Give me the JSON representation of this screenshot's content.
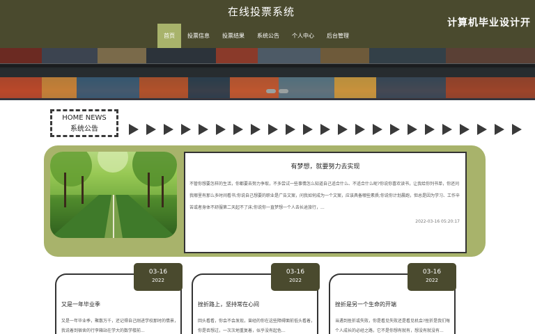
{
  "header": {
    "site_title": "在线投票系统",
    "watermark": "计算机毕业设计开",
    "nav": [
      {
        "label": "首页",
        "active": true
      },
      {
        "label": "投票信息",
        "active": false
      },
      {
        "label": "投票结果",
        "active": false
      },
      {
        "label": "系统公告",
        "active": false
      },
      {
        "label": "个人中心",
        "active": false
      },
      {
        "label": "后台管理",
        "active": false
      }
    ]
  },
  "banner": {
    "slides": 2,
    "active_slide": 1
  },
  "news_section": {
    "title_en": "HOME NEWS",
    "title_cn": "系统公告"
  },
  "featured": {
    "title": "有梦想，就要努力去实现",
    "text": "不管你想要怎样的生活，你都要去努力争取，不多尝试一些事情怎么知道自己适合什么、不适合什么呢?你说你喜欢读书，让我给你列书单，你还问我哪里有那么多时间看书;你说自己想要的职业是广告文案，问我如何成为一个文案，应该具备哪些素质;你说你计划晨跑，但总是因为学习、工作辛苦或者身体不舒服第二天起不了床;你说你一直梦想一个人去长途旅行，...",
    "date": "2022-03-16 05:20:17"
  },
  "cards": [
    {
      "month_day": "03-16",
      "year": "2022",
      "title": "又是一年毕业季",
      "text": "又是一年毕业季，聚散万千，还记得自己刚进学校那时的情景，我说着到宿舍的行李箱站在学大的数学楼前..."
    },
    {
      "month_day": "03-16",
      "year": "2022",
      "title": "挫折路上，坚持常在心间",
      "text": "回头看看，你会不会发现，曾经的你在这些障碍面前低头看着，你是否想过，一次次地重复着，似乎没有起色..."
    },
    {
      "month_day": "03-16",
      "year": "2022",
      "title": "挫折是另一个生命的开端",
      "text": "当遇到挫折或失败，你是看见失败还是看见机会?挫折是我们每个人成长的必经之路，它不是你想有就有，想没有就没有..."
    }
  ],
  "colors": {
    "header_bg": "#4a4a2e",
    "accent": "#a8b36b",
    "text": "#222222"
  }
}
